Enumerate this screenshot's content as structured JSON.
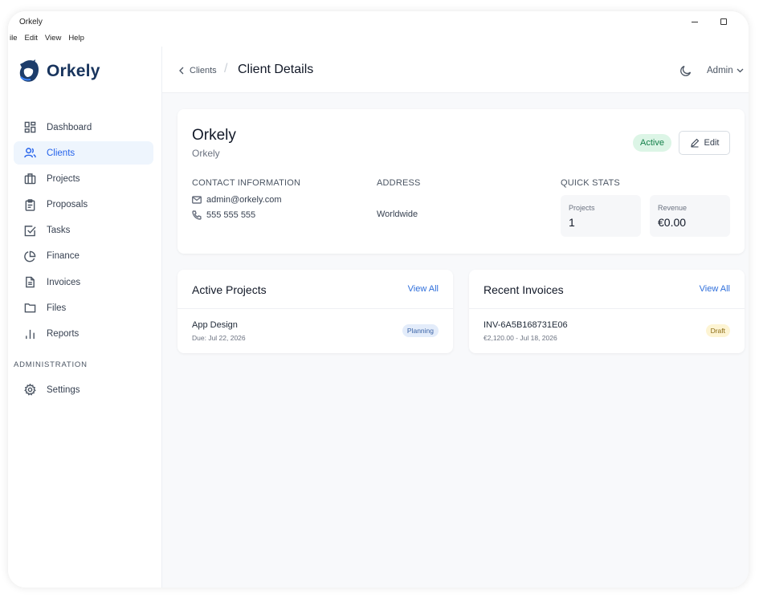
{
  "window": {
    "title": "Orkely"
  },
  "menu": [
    "ile",
    "Edit",
    "View",
    "Help"
  ],
  "brand": {
    "name": "Orkely"
  },
  "sidebar": {
    "items": [
      {
        "label": "Dashboard",
        "icon": "dashboard-icon"
      },
      {
        "label": "Clients",
        "icon": "users-icon",
        "active": true
      },
      {
        "label": "Projects",
        "icon": "briefcase-icon"
      },
      {
        "label": "Proposals",
        "icon": "clipboard-icon"
      },
      {
        "label": "Tasks",
        "icon": "checkbox-icon"
      },
      {
        "label": "Finance",
        "icon": "pie-chart-icon"
      },
      {
        "label": "Invoices",
        "icon": "document-icon"
      },
      {
        "label": "Files",
        "icon": "folder-icon"
      },
      {
        "label": "Reports",
        "icon": "bar-chart-icon"
      }
    ],
    "section_label": "ADMINISTRATION",
    "admin_items": [
      {
        "label": "Settings",
        "icon": "gear-icon"
      }
    ]
  },
  "header": {
    "breadcrumb_parent": "Clients",
    "title": "Client Details",
    "user_menu": "Admin"
  },
  "client": {
    "name": "Orkely",
    "subtitle": "Orkely",
    "status": "Active",
    "edit_label": "Edit",
    "contact_label": "CONTACT INFORMATION",
    "email": "admin@orkely.com",
    "phone": "555 555 555",
    "address_label": "ADDRESS",
    "address": "Worldwide",
    "stats_label": "QUICK STATS",
    "stats": [
      {
        "label": "Projects",
        "value": "1"
      },
      {
        "label": "Revenue",
        "value": "€0.00"
      }
    ]
  },
  "active_projects": {
    "title": "Active Projects",
    "view_all": "View All",
    "items": [
      {
        "name": "App Design",
        "sub": "Due: Jul 22, 2026",
        "status": "Planning"
      }
    ]
  },
  "recent_invoices": {
    "title": "Recent Invoices",
    "view_all": "View All",
    "items": [
      {
        "name": "INV-6A5B168731E06",
        "sub": "€2,120.00 - Jul 18, 2026",
        "status": "Draft"
      }
    ]
  },
  "colors": {
    "accent": "#2563eb",
    "active_badge_bg": "#dcf5e6",
    "planning_bg": "#e3ecfa",
    "draft_bg": "#fdf4d3"
  }
}
